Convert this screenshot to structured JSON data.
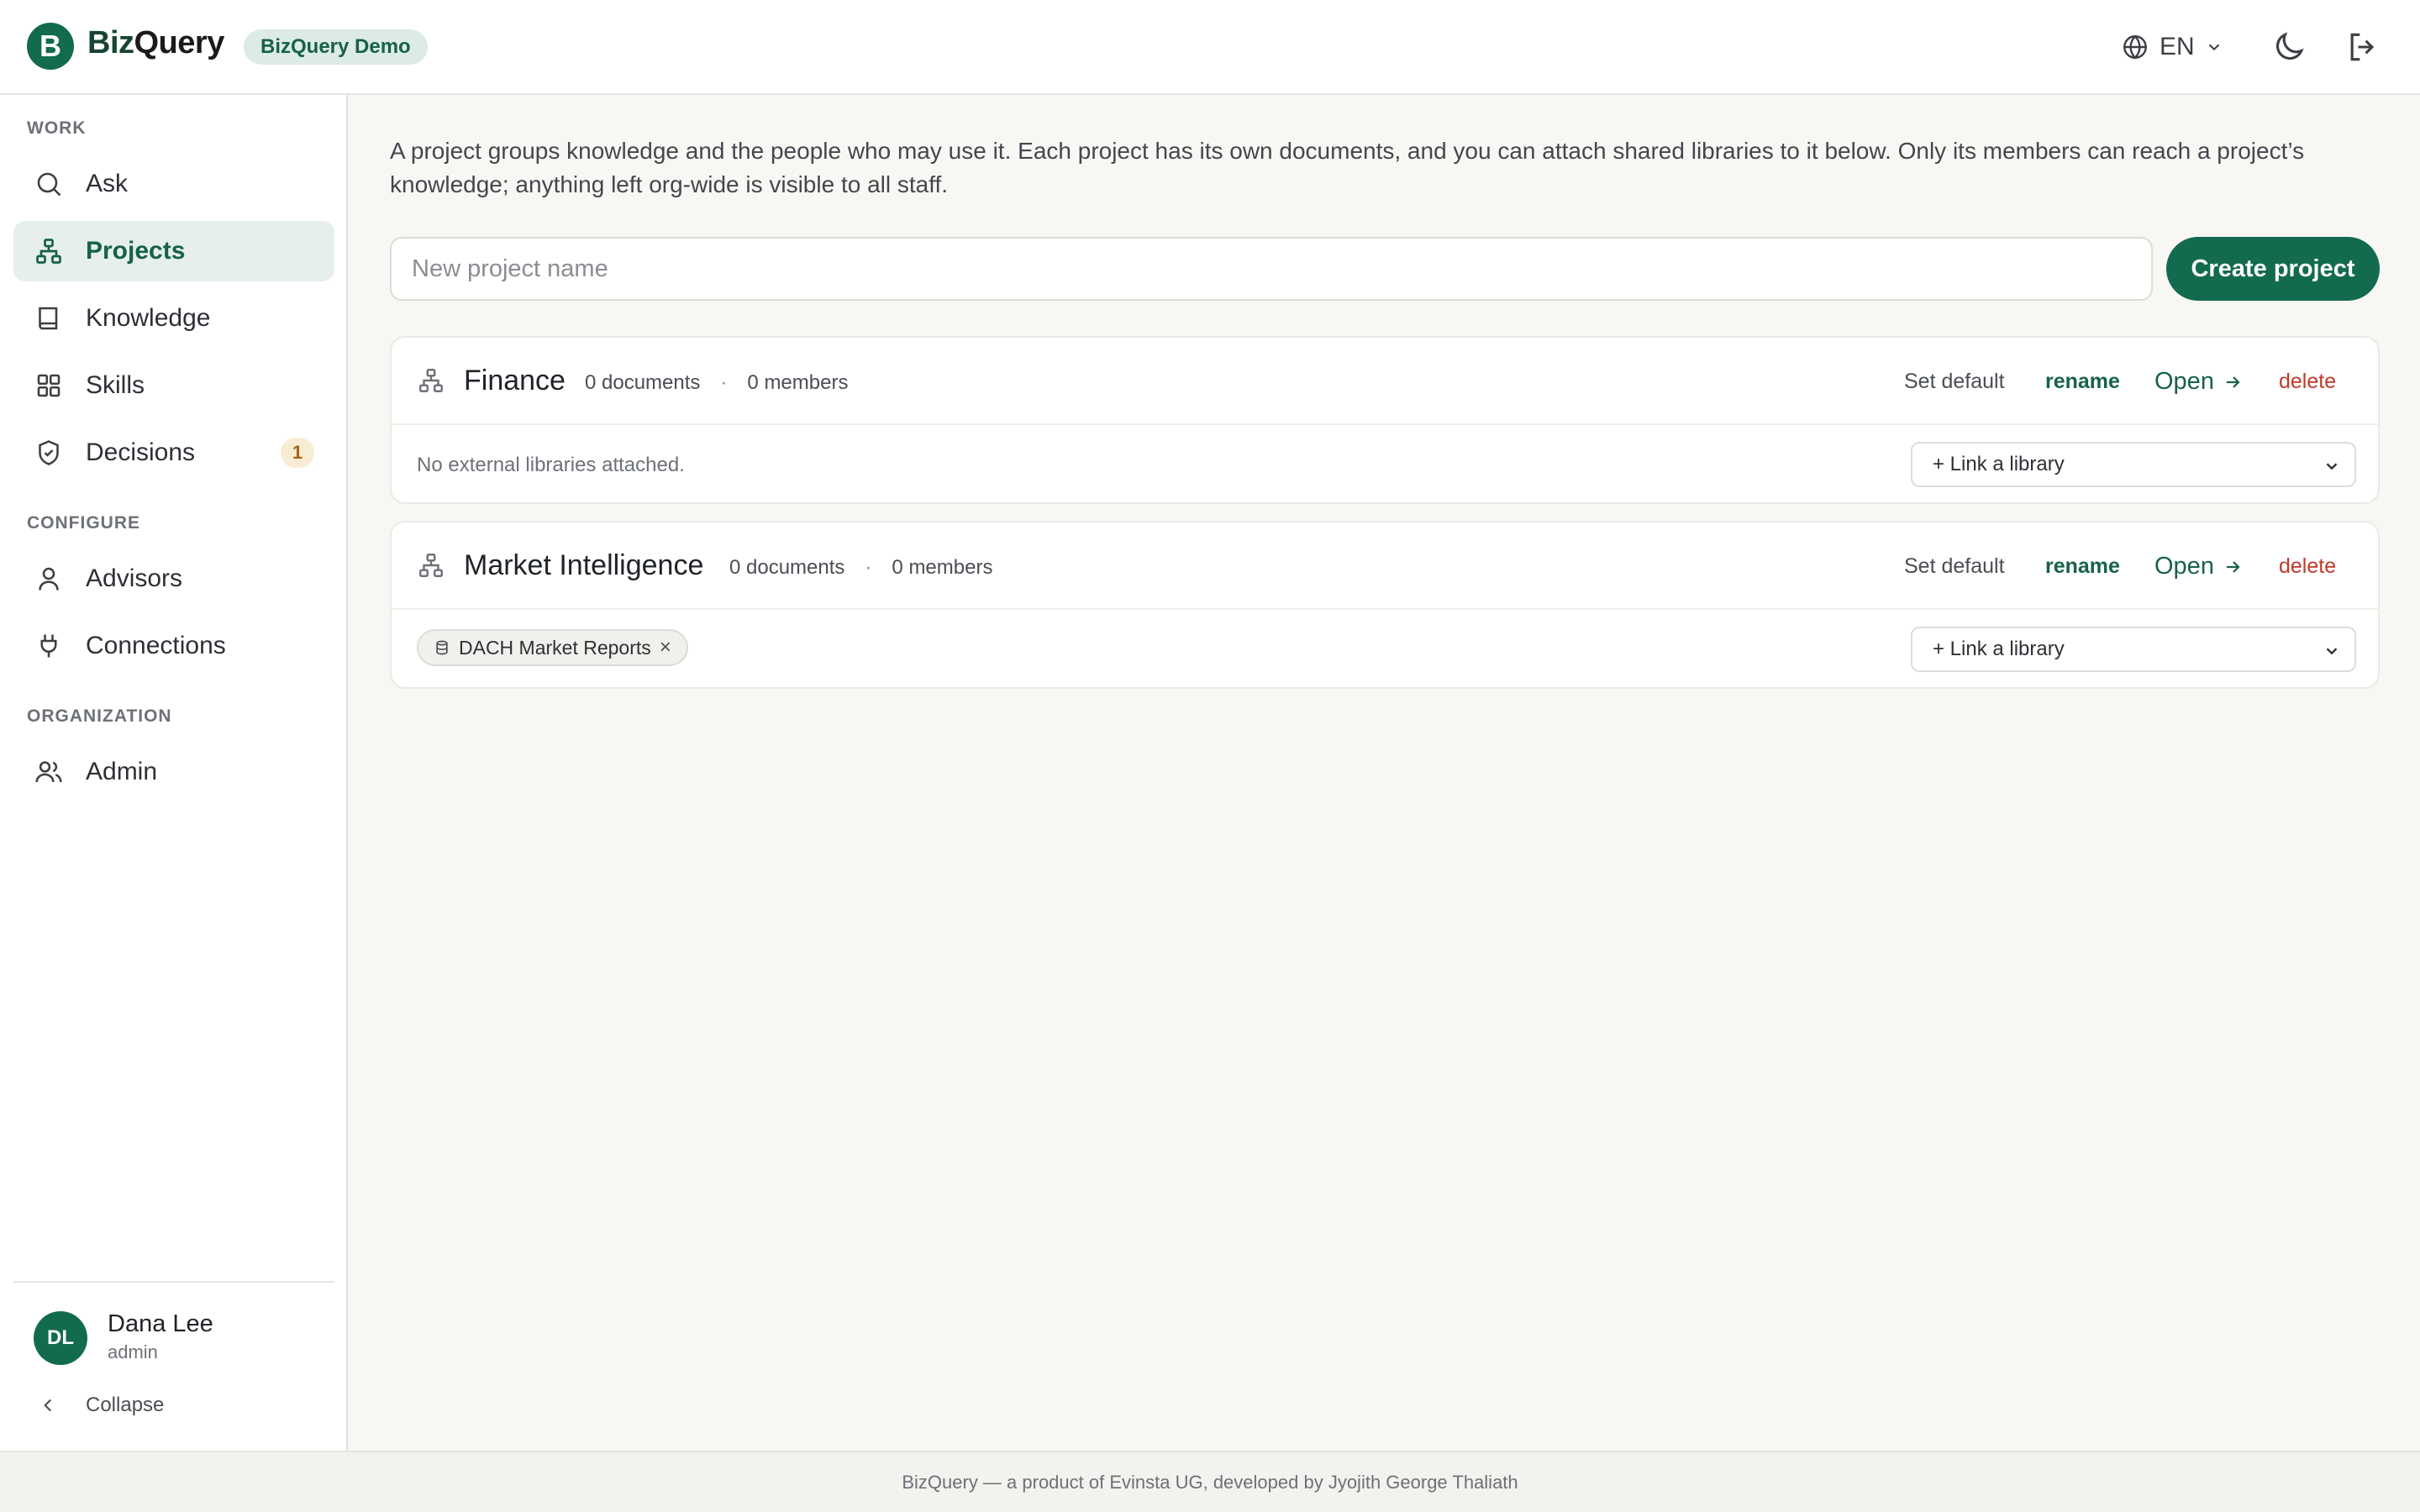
{
  "header": {
    "logo_letter": "B",
    "brand_primary": "Biz",
    "brand_secondary": "Query",
    "demo_badge": "BizQuery Demo",
    "language": "EN",
    "icons": [
      "globe-icon",
      "chevron-down-icon",
      "moon-icon",
      "logout-icon"
    ]
  },
  "sidebar": {
    "sections": {
      "work": "WORK",
      "configure": "CONFIGURE",
      "organization": "ORGANIZATION"
    },
    "items": {
      "ask": "Ask",
      "projects": "Projects",
      "knowledge": "Knowledge",
      "skills": "Skills",
      "decisions": "Decisions",
      "advisors": "Advisors",
      "connections": "Connections",
      "admin": "Admin"
    },
    "active_item": "Projects",
    "decisions_badge": "1",
    "user": {
      "initials": "DL",
      "name": "Dana Lee",
      "role": "admin"
    },
    "collapse_label": "Collapse"
  },
  "main": {
    "intro": "A project groups knowledge and the people who may use it. Each project has its own documents, and you can attach shared libraries to it below. Only its members can reach a project’s knowledge; anything left org-wide is visible to all staff.",
    "new_project_placeholder": "New project name",
    "create_button": "Create project",
    "actions": {
      "set_default": "Set default",
      "rename": "rename",
      "open": "Open",
      "delete": "delete"
    },
    "link_library_label": "+ Link a library",
    "projects": [
      {
        "name": "Finance",
        "documents": "0 documents",
        "members": "0 members",
        "no_libraries": "No external libraries attached."
      },
      {
        "name": "Market Intelligence",
        "documents": "0 documents",
        "members": "0 members",
        "libraries": [
          "DACH Market Reports"
        ],
        "remove_symbol": "×"
      }
    ]
  },
  "footer": {
    "text": "BizQuery — a product of Evinsta UG, developed by Jyojith George Thaliath"
  },
  "colors": {
    "brand_green": "#136b4f",
    "active_nav_bg": "#e6efeb",
    "delete_red": "#c0392b",
    "badge_amber_bg": "#f8ecd5",
    "page_bg": "#f8f7f4"
  }
}
